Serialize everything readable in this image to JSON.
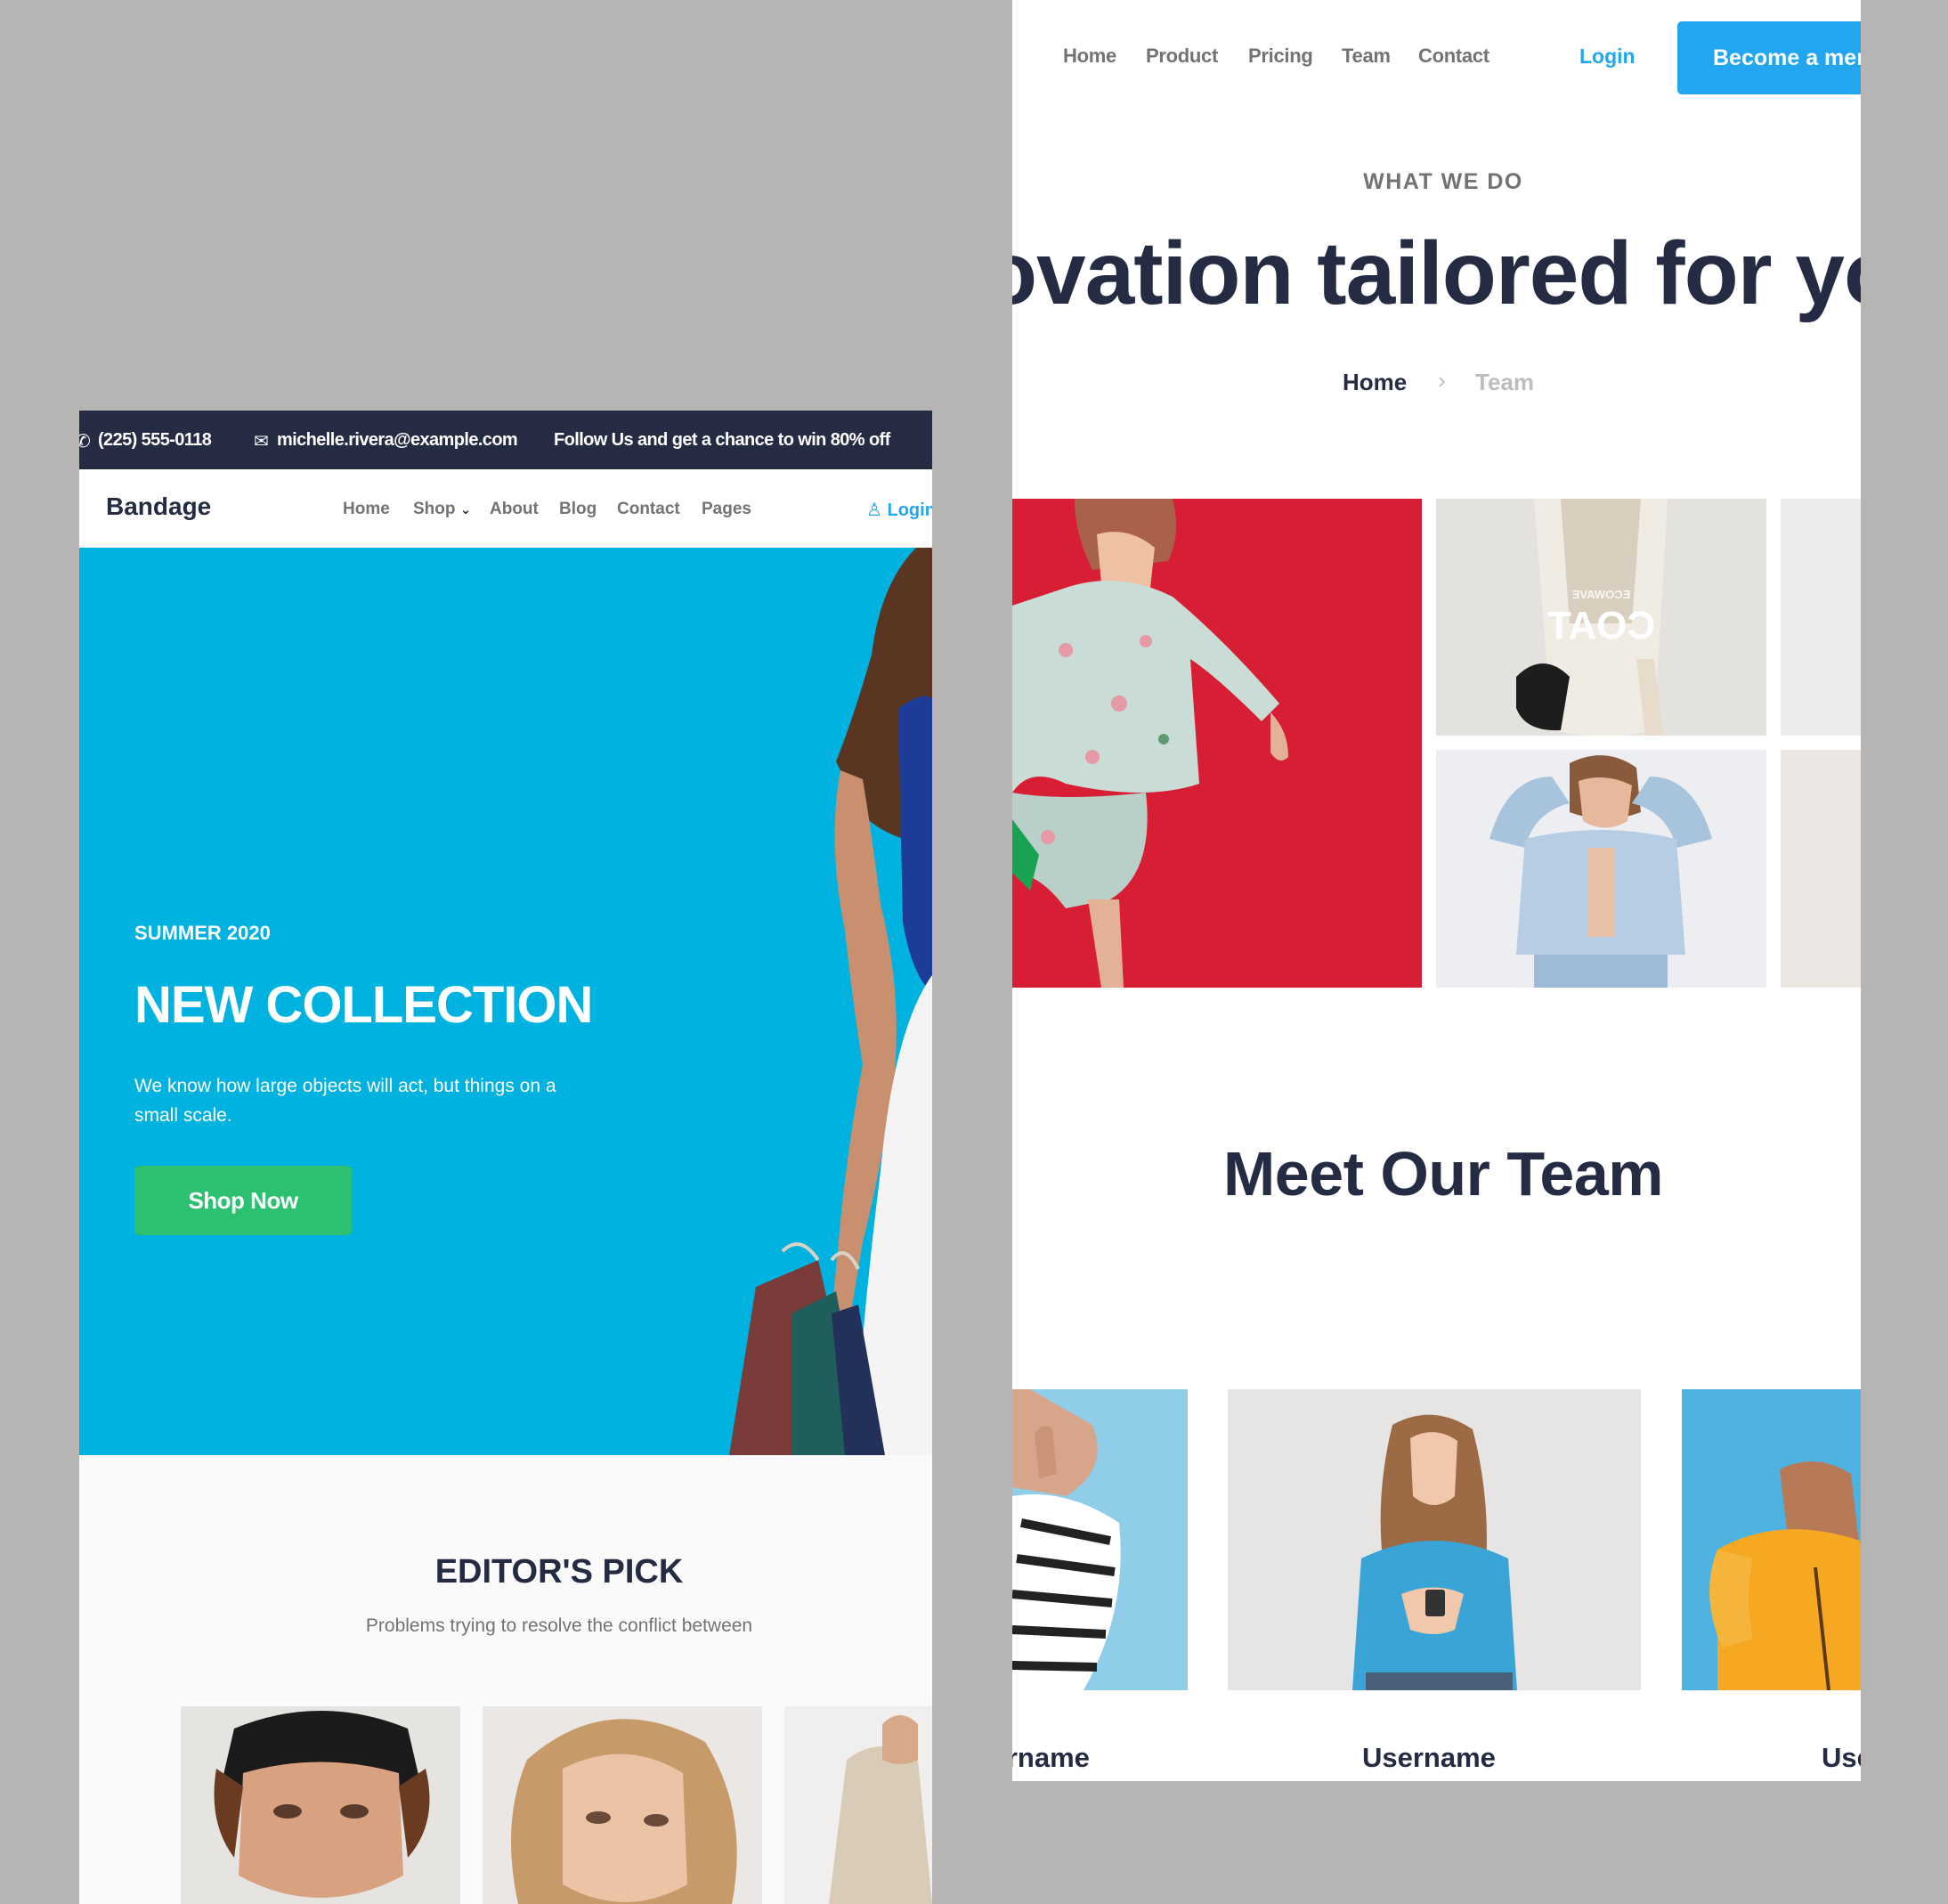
{
  "left_page": {
    "topbar": {
      "phone": "(225) 555-0118",
      "email": "michelle.rivera@example.com",
      "promo": "Follow Us  and get a chance to win 80% off"
    },
    "brand": "Bandage",
    "nav": [
      "Home",
      "Shop",
      "About",
      "Blog",
      "Contact",
      "Pages"
    ],
    "login": "Login",
    "hero": {
      "subtitle": "SUMMER 2020",
      "title": "NEW COLLECTION",
      "description": "We know how large objects will act, but things on a small scale.",
      "button": "Shop Now"
    },
    "editors_pick": {
      "title": "EDITOR'S PICK",
      "subtitle": "Problems trying to resolve the conflict between"
    }
  },
  "right_page": {
    "nav": [
      "Home",
      "Product",
      "Pricing",
      "Team",
      "Contact"
    ],
    "login": "Login",
    "cta": "Become a member",
    "eyebrow": "WHAT WE DO",
    "title": "Innovation tailored for you",
    "breadcrumb": {
      "home": "Home",
      "current": "Team"
    },
    "gallery_caption_small": "ECOWAVE",
    "gallery_caption": "COAT",
    "section_title": "Meet Our Team",
    "usernames": [
      "Username",
      "Username",
      "Username"
    ]
  },
  "colors": {
    "background": "#b6b5b4",
    "dark_navy": "#252b42",
    "hero_blue": "#00b3e0",
    "primary_blue": "#23a6f0",
    "success_green": "#2dc071",
    "gallery_red": "#d81e35"
  }
}
